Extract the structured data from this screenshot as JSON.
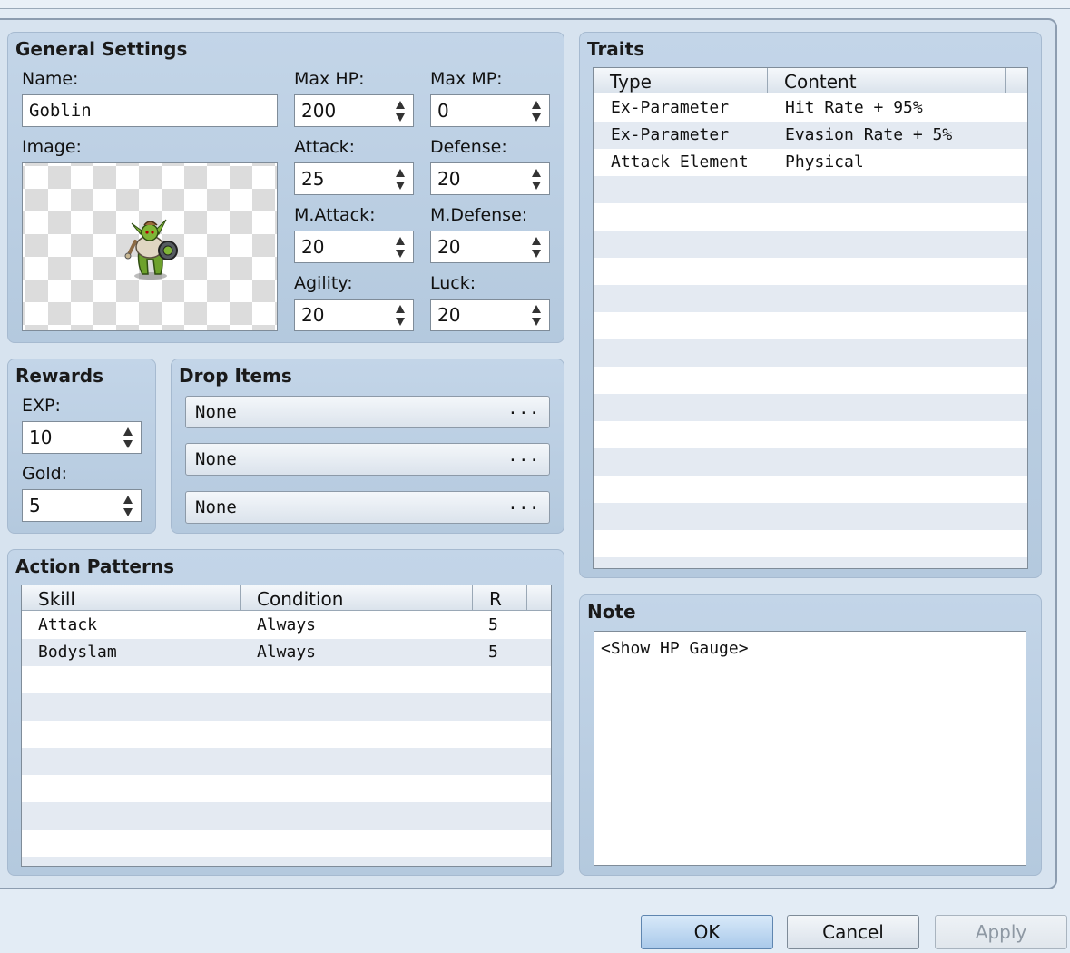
{
  "general": {
    "title": "General Settings",
    "name_label": "Name:",
    "name_value": "Goblin",
    "image_label": "Image:",
    "max_hp_label": "Max HP:",
    "max_hp": "200",
    "max_mp_label": "Max MP:",
    "max_mp": "0",
    "attack_label": "Attack:",
    "attack": "25",
    "defense_label": "Defense:",
    "defense": "20",
    "m_attack_label": "M.Attack:",
    "m_attack": "20",
    "m_defense_label": "M.Defense:",
    "m_defense": "20",
    "agility_label": "Agility:",
    "agility": "20",
    "luck_label": "Luck:",
    "luck": "20"
  },
  "rewards": {
    "title": "Rewards",
    "exp_label": "EXP:",
    "exp": "10",
    "gold_label": "Gold:",
    "gold": "5"
  },
  "drops": {
    "title": "Drop Items",
    "items": [
      {
        "label": "None",
        "more": "..."
      },
      {
        "label": "None",
        "more": "..."
      },
      {
        "label": "None",
        "more": "..."
      }
    ]
  },
  "actions": {
    "title": "Action Patterns",
    "headers": [
      "Skill",
      "Condition",
      "R"
    ],
    "rows": [
      {
        "skill": "Attack",
        "condition": "Always",
        "r": "5"
      },
      {
        "skill": "Bodyslam",
        "condition": "Always",
        "r": "5"
      }
    ]
  },
  "traits": {
    "title": "Traits",
    "headers": [
      "Type",
      "Content"
    ],
    "rows": [
      {
        "type": "Ex-Parameter",
        "content": "Hit Rate + 95%"
      },
      {
        "type": "Ex-Parameter",
        "content": "Evasion Rate + 5%"
      },
      {
        "type": "Attack Element",
        "content": "Physical"
      }
    ]
  },
  "note": {
    "title": "Note",
    "value": "<Show HP Gauge>"
  },
  "buttons": {
    "ok": "OK",
    "cancel": "Cancel",
    "apply": "Apply"
  }
}
